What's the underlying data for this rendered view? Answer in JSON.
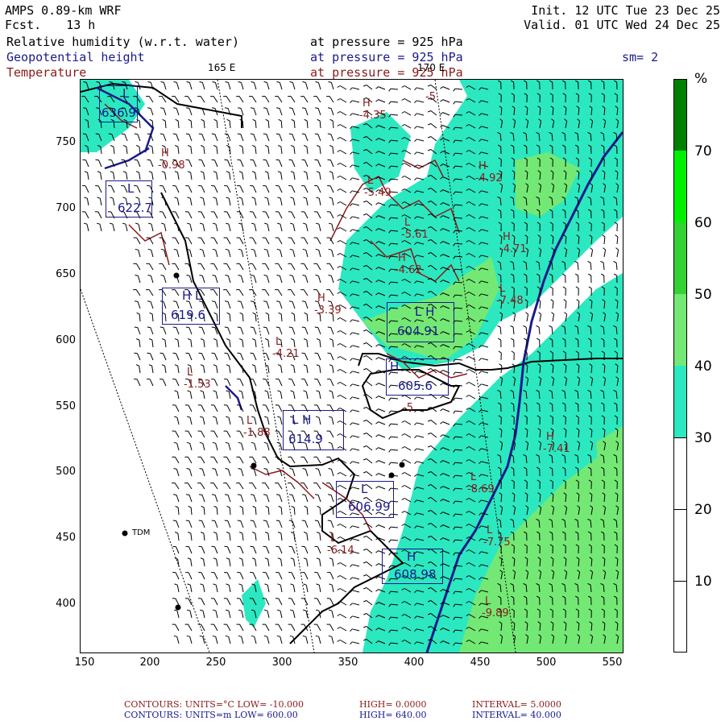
{
  "header": {
    "model": "AMPS 0.89-km WRF",
    "forecast_label": "Fcst.",
    "forecast_hours": "13 h",
    "init": "Init. 12 UTC Tue 23 Dec 25",
    "valid": "Valid. 01 UTC Wed 24 Dec 25",
    "field1": "Relative humidity (w.r.t. water)",
    "field2": "Geopotential height",
    "field3": "Temperature",
    "pressure1": "at pressure =  925 hPa",
    "pressure2": "at pressure =  925 hPa",
    "pressure3": "at pressure =  925 hPa",
    "smoothing": "sm= 2",
    "meridian_165": "165 E",
    "meridian_170": "170 E"
  },
  "colors": {
    "rh_30_40": "#2be8c0",
    "rh_40_50": "#74e874",
    "rh_50_60": "#33d133",
    "rh_60_70": "#00f000",
    "rh_70_plus": "#008000",
    "geopotential": "#1a1a8c",
    "temperature": "#8b1a1a"
  },
  "map": {
    "y_ticks": [
      "400",
      "450",
      "500",
      "550",
      "600",
      "650",
      "700",
      "750"
    ],
    "x_ticks": [
      "150",
      "200",
      "250",
      "300",
      "350",
      "400",
      "450",
      "500",
      "550"
    ],
    "station_label": "TDM",
    "height_boxes": [
      {
        "label": "L",
        "value": "636.9"
      },
      {
        "label": "L",
        "value": "622.7"
      },
      {
        "label": "H L",
        "value": "619.6"
      },
      {
        "label": "L H",
        "value": "614.9"
      },
      {
        "label": "L H",
        "value": "604.91"
      },
      {
        "label": "H",
        "value": "605.6"
      },
      {
        "label": "L",
        "value": "606.99"
      },
      {
        "label": "H",
        "value": "608.98"
      }
    ],
    "temp_labels": [
      {
        "label": "H",
        "value": "-4.35"
      },
      {
        "label": "L",
        "value": "-5.49"
      },
      {
        "label": "L",
        "value": "-5.61"
      },
      {
        "label": "H",
        "value": "-4.62"
      },
      {
        "label": "H",
        "value": "-3.39"
      },
      {
        "label": "L",
        "value": "-4.21"
      },
      {
        "label": "H",
        "value": "-4.92"
      },
      {
        "label": "H",
        "value": "-4.71"
      },
      {
        "label": "L",
        "value": "-7.48"
      },
      {
        "label": "H",
        "value": "-7.41"
      },
      {
        "label": "L",
        "value": "-8.69"
      },
      {
        "label": "L",
        "value": "-7.75"
      },
      {
        "label": "L",
        "value": "-9.89"
      },
      {
        "label": "L",
        "value": "-6.14"
      },
      {
        "label": "L",
        "value": "-1.53"
      },
      {
        "label": "L",
        "value": "-1.88"
      },
      {
        "label": "H",
        "value": "-0.98"
      },
      {
        "label": "",
        "value": "-5"
      },
      {
        "label": "",
        "value": "-5"
      }
    ]
  },
  "colorbar": {
    "unit": "%",
    "labels": [
      "70",
      "60",
      "50",
      "40",
      "30",
      "20",
      "10"
    ]
  },
  "footer": {
    "row1_a": "CONTOURS:  UNITS=°C  LOW=  -10.000",
    "row1_b": "HIGH=   0.0000",
    "row1_c": "INTERVAL=    5.0000",
    "row2_a": "CONTOURS:  UNITS=m  LOW=   600.00",
    "row2_b": "HIGH=   640.00",
    "row2_c": "INTERVAL=    40.000"
  }
}
